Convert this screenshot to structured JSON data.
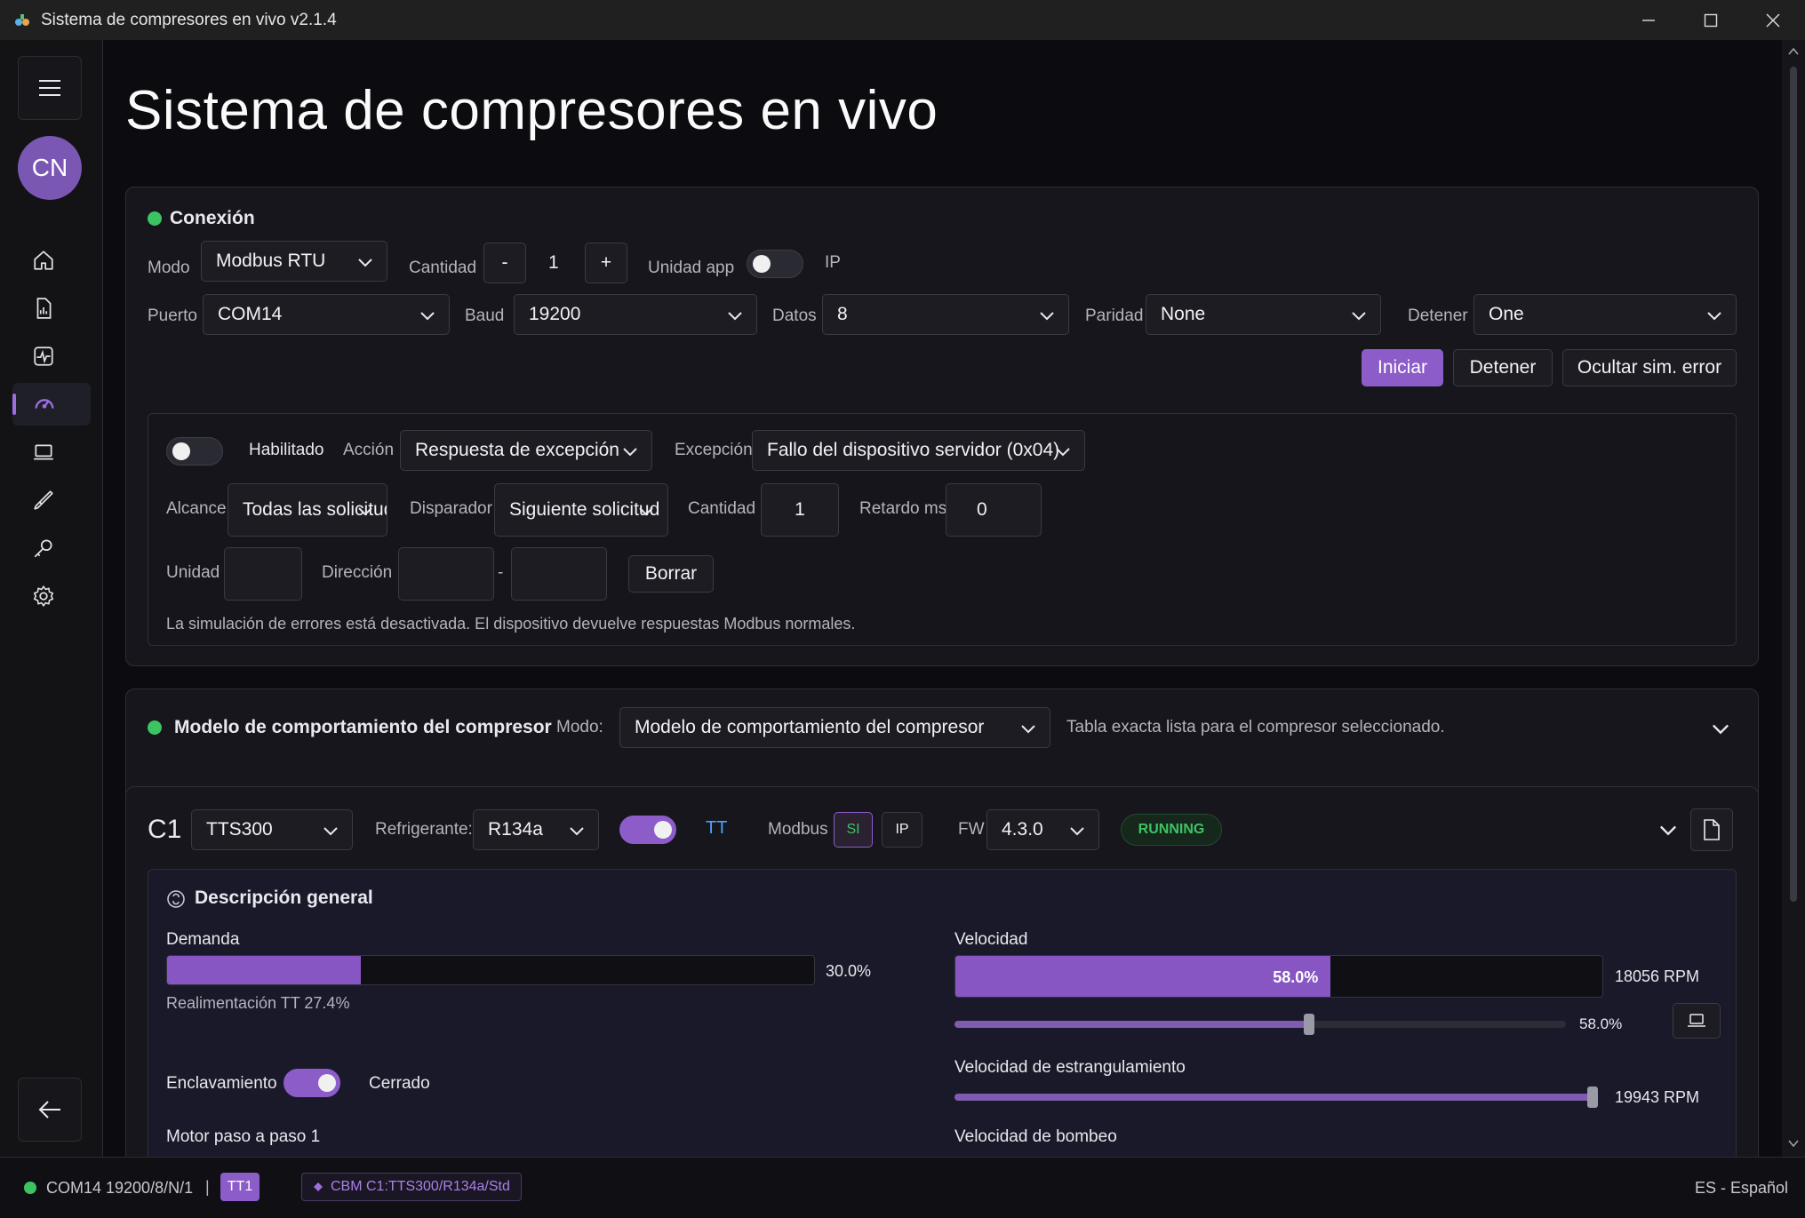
{
  "window": {
    "title": "Sistema de compresores en vivo v2.1.4"
  },
  "sidebar": {
    "avatar": "CN"
  },
  "page": {
    "title": "Sistema de compresores en vivo"
  },
  "connection": {
    "header": "Conexión",
    "mode_label": "Modo",
    "mode_value": "Modbus RTU",
    "quantity_label": "Cantidad",
    "quantity_minus": "-",
    "quantity_value": "1",
    "quantity_plus": "+",
    "unit_app_label": "Unidad app",
    "unit_app_on": false,
    "ip_label": "IP",
    "port_label": "Puerto",
    "port_value": "COM14",
    "baud_label": "Baud",
    "baud_value": "19200",
    "data_label": "Datos",
    "data_value": "8",
    "parity_label": "Paridad",
    "parity_value": "None",
    "stop_label": "Detener",
    "stop_value": "One",
    "start_button": "Iniciar",
    "stop_button": "Detener",
    "hide_error_button": "Ocultar sim. error"
  },
  "error_sim": {
    "enabled": false,
    "enabled_label": "Habilitado",
    "action_label": "Acción",
    "action_value": "Respuesta de excepción",
    "exception_label": "Excepción",
    "exception_value": "Fallo del dispositivo servidor (0x04)",
    "scope_label": "Alcance",
    "scope_value": "Todas las solicitudes",
    "trigger_label": "Disparador",
    "trigger_value": "Siguiente solicitud",
    "count_label": "Cantidad",
    "count_value": "1",
    "delay_label": "Retardo ms",
    "delay_value": "0",
    "unit_label": "Unidad",
    "unit_value": "",
    "address_label": "Dirección",
    "address_sep": "-",
    "address_from": "",
    "address_to": "",
    "clear_button": "Borrar",
    "status_text": "La simulación de errores está desactivada. El dispositivo devuelve respuestas Modbus normales."
  },
  "behavior": {
    "title": "Modelo de comportamiento del compresor",
    "mode_label": "Modo:",
    "mode_value": "Modelo de comportamiento del compresor",
    "note": "Tabla exacta lista para el compresor seleccionado."
  },
  "compressor": {
    "id": "C1",
    "model": "TTS300",
    "refrigerant_label": "Refrigerante:",
    "refrigerant": "R134a",
    "tt_on": true,
    "tt_label": "TT",
    "modbus_label": "Modbus",
    "modbus_si": "SI",
    "modbus_ip": "IP",
    "fw_label": "FW",
    "fw_value": "4.3.0",
    "status": "RUNNING",
    "overview_title": "Descripción general",
    "demand_label": "Demanda",
    "demand_fraction": 0.3,
    "demand_text": "30.0%",
    "feedback_text": "Realimentación TT 27.4%",
    "speed_label": "Velocidad",
    "speed_fraction": 0.58,
    "speed_text": "58.0%",
    "speed_rpm": "18056 RPM",
    "speed_slider_fraction": 0.58,
    "speed_slider_text": "58.0%",
    "choke_label": "Velocidad de estrangulamiento",
    "choke_fraction": 1.0,
    "choke_rpm": "19943 RPM",
    "surge_label": "Velocidad de bombeo",
    "interlock_label": "Enclavamiento",
    "interlock_on": true,
    "interlock_state": "Cerrado",
    "stepper_label": "Motor paso a paso 1"
  },
  "statusbar": {
    "port_info": "COM14 19200/8/N/1",
    "separator": "|",
    "tt_badge": "TT1",
    "cbm_badge": "CBM C1:TTS300/R134a/Std",
    "language": "ES - Español"
  },
  "colors": {
    "accent": "#8c5cc9",
    "ok": "#3cc463",
    "running": "#3cc463",
    "link": "#4aa3ff"
  }
}
